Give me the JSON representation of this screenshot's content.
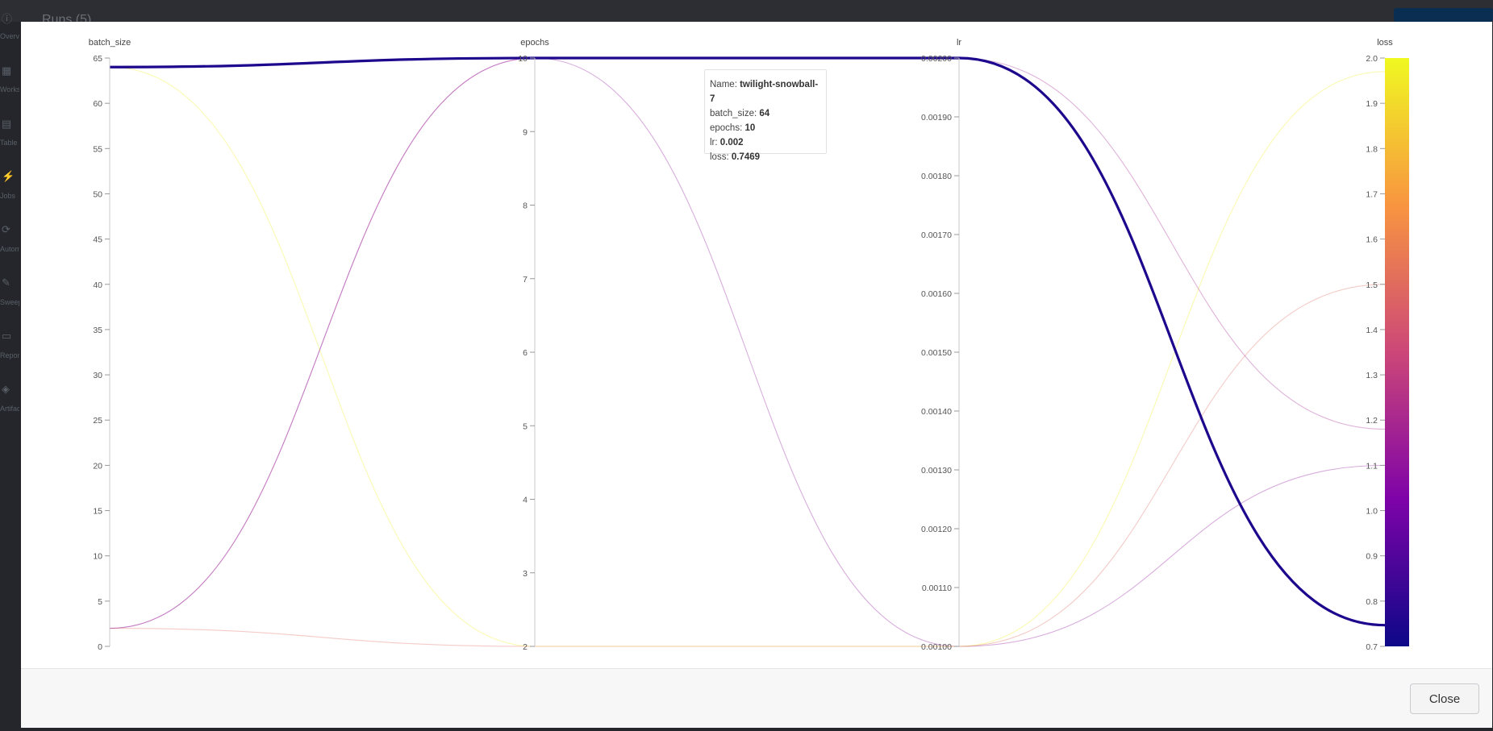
{
  "background_app": {
    "title": "Runs (5)",
    "sidebar_labels": [
      "Overview",
      "Workspace",
      "Table",
      "Jobs",
      "Automations",
      "Sweeps",
      "Reports",
      "Artifacts"
    ]
  },
  "modal": {
    "close_label": "Close"
  },
  "tooltip": {
    "name_label": "Name",
    "name_value": "twilight-snowball-7",
    "batch_label": "batch_size",
    "batch_value": "64",
    "epochs_label": "epochs",
    "epochs_value": "10",
    "lr_label": "lr",
    "lr_value": "0.002",
    "loss_label": "loss",
    "loss_value": "0.7469"
  },
  "chart_data": {
    "type": "parallel_coordinates",
    "axes": [
      {
        "name": "batch_size",
        "range": [
          0,
          65
        ],
        "ticks": [
          "0",
          "5",
          "10",
          "15",
          "20",
          "25",
          "30",
          "35",
          "40",
          "45",
          "50",
          "55",
          "60",
          "65"
        ]
      },
      {
        "name": "epochs",
        "range": [
          2,
          10
        ],
        "ticks": [
          "2",
          "3",
          "4",
          "5",
          "6",
          "7",
          "8",
          "9",
          "10"
        ]
      },
      {
        "name": "lr",
        "range": [
          0.001,
          0.002
        ],
        "ticks": [
          "0.00100",
          "0.00110",
          "0.00120",
          "0.00130",
          "0.00140",
          "0.00150",
          "0.00160",
          "0.00170",
          "0.00180",
          "0.00190",
          "0.00200"
        ]
      },
      {
        "name": "loss",
        "range": [
          0.7,
          2.0
        ],
        "ticks": [
          "0.7",
          "0.8",
          "0.9",
          "1.0",
          "1.1",
          "1.2",
          "1.3",
          "1.4",
          "1.5",
          "1.6",
          "1.7",
          "1.8",
          "1.9",
          "2.0"
        ]
      }
    ],
    "colorscale": {
      "stops": [
        "#0d0887",
        "#7e03a8",
        "#cc4778",
        "#f89540",
        "#f0f921"
      ],
      "range": [
        0.7,
        2.0
      ]
    },
    "runs": [
      {
        "name": "twilight-snowball-7",
        "batch_size": 64,
        "epochs": 10,
        "lr": 0.002,
        "loss": 0.7469,
        "highlighted": true
      },
      {
        "batch_size": 2,
        "epochs": 10,
        "lr": 0.001,
        "loss": 1.1
      },
      {
        "batch_size": 64,
        "epochs": 2,
        "lr": 0.001,
        "loss": 1.97
      },
      {
        "batch_size": 2,
        "epochs": 2,
        "lr": 0.001,
        "loss": 1.5
      },
      {
        "batch_size": 2,
        "epochs": 10,
        "lr": 0.002,
        "loss": 1.18
      }
    ]
  }
}
